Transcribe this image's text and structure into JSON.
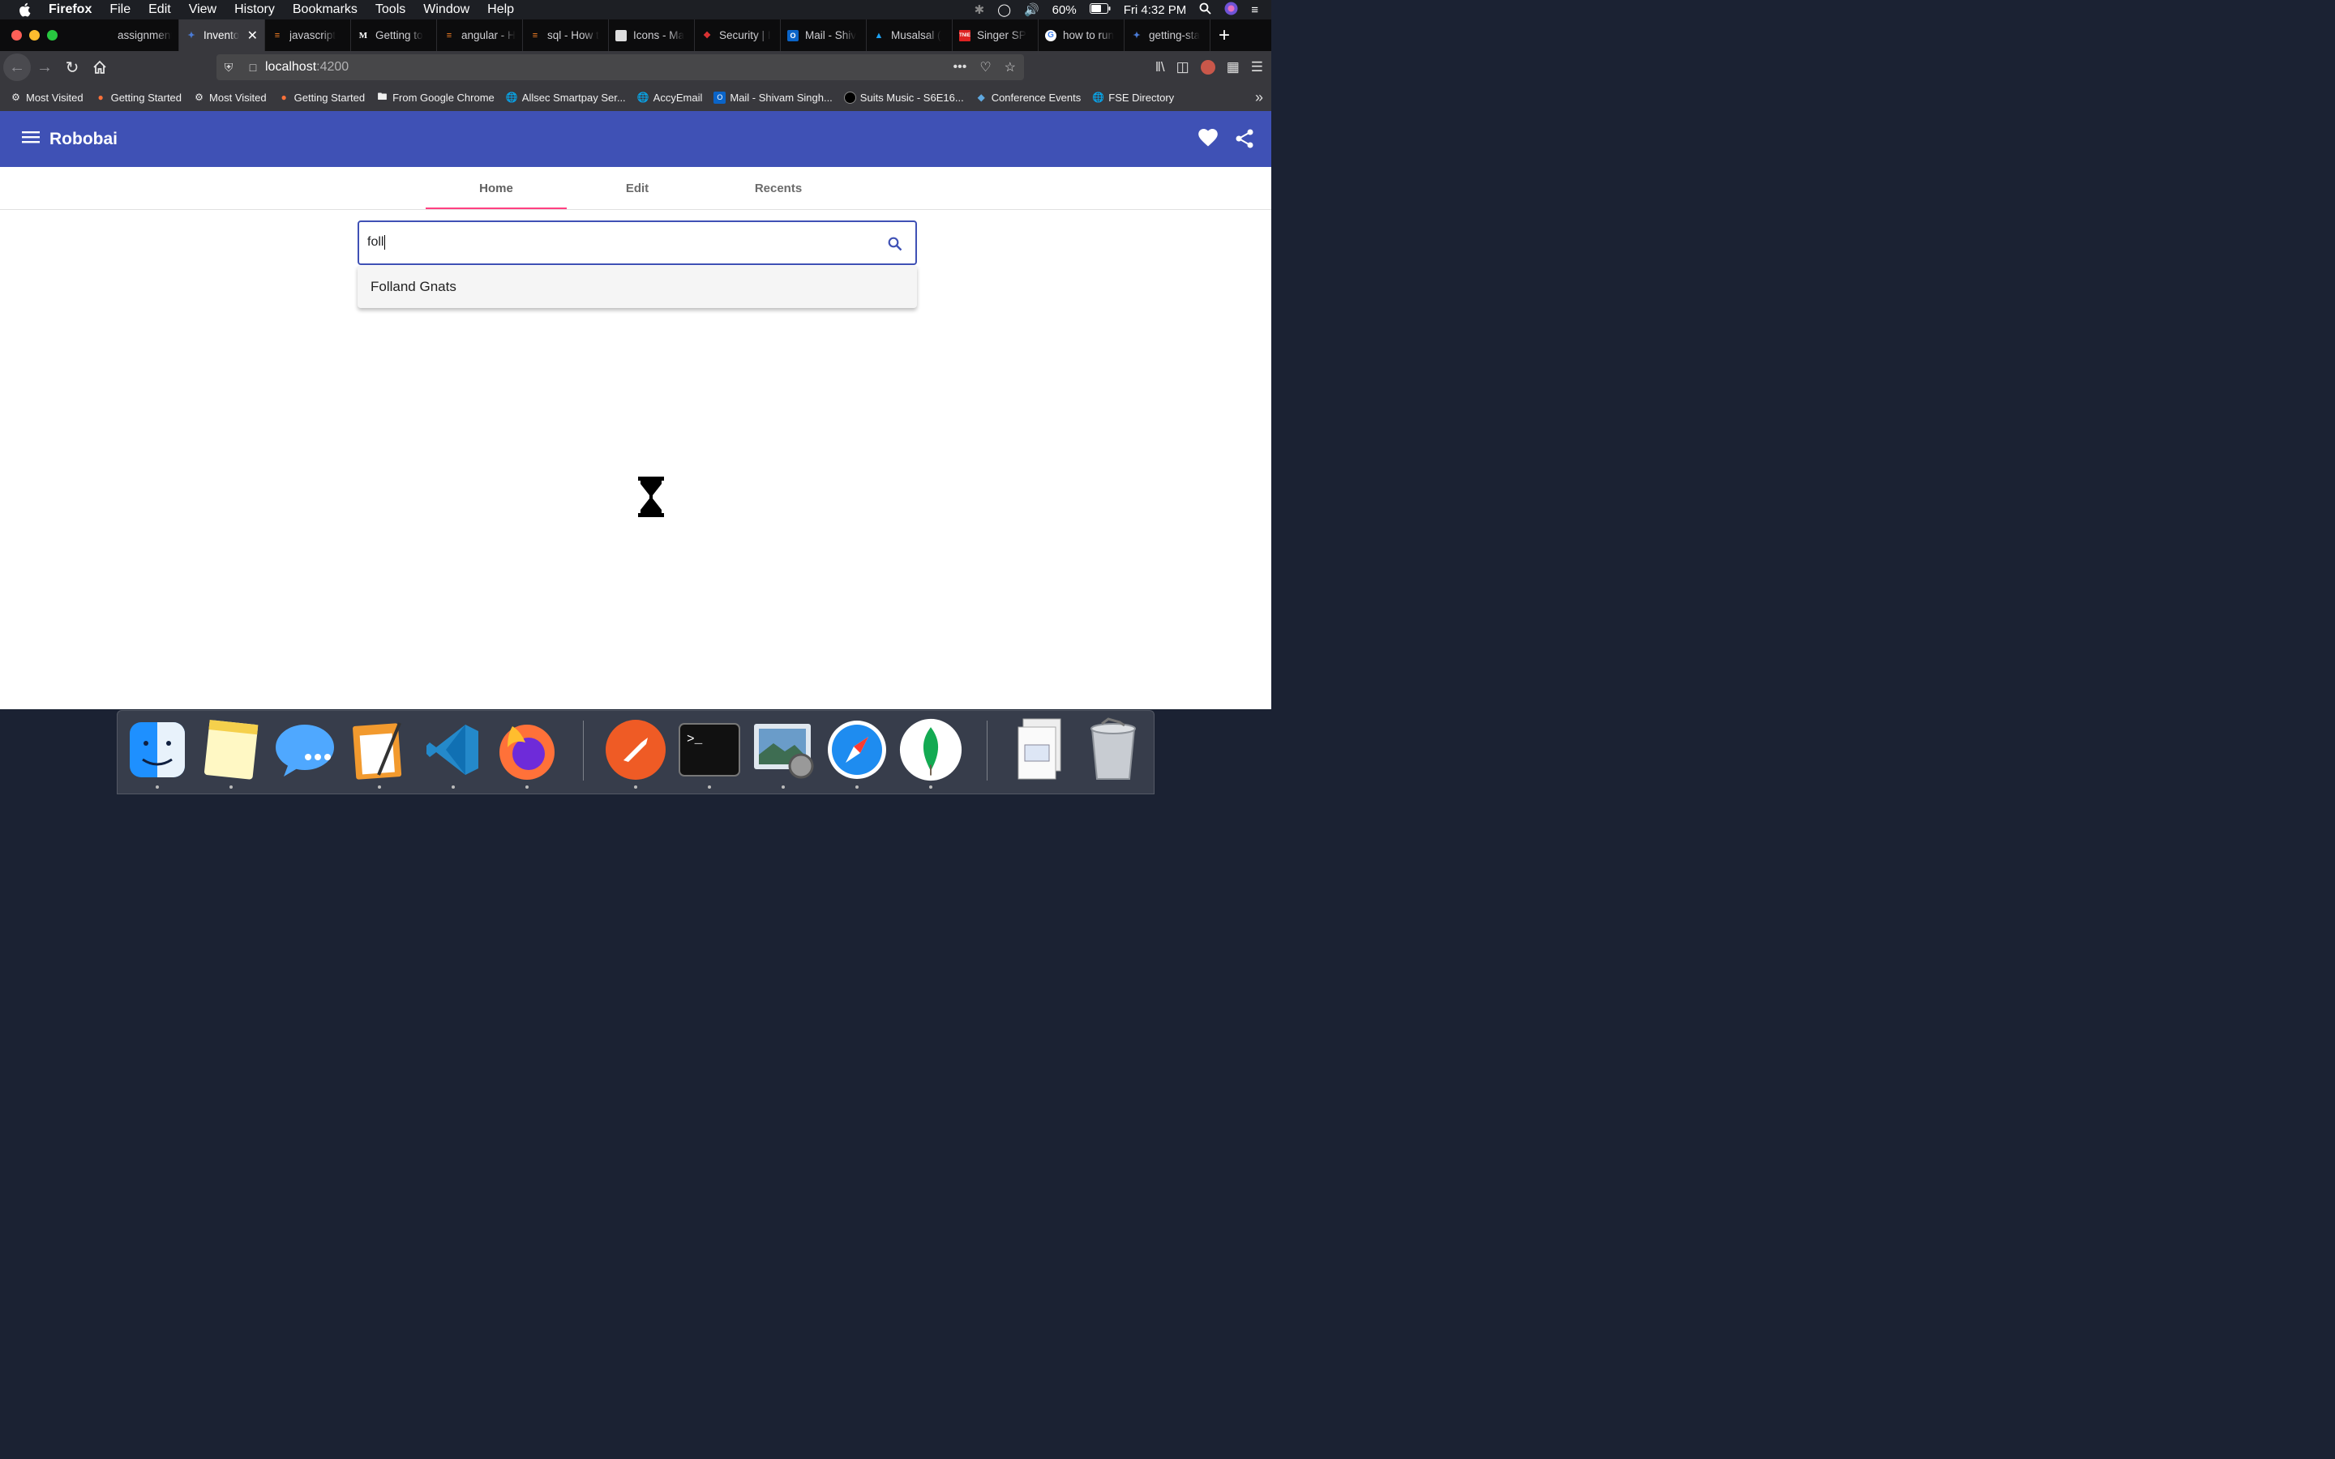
{
  "menubar": {
    "app_name": "Firefox",
    "items": [
      "File",
      "Edit",
      "View",
      "History",
      "Bookmarks",
      "Tools",
      "Window",
      "Help"
    ],
    "battery": "60%",
    "clock": "Fri 4:32 PM"
  },
  "tabs": [
    {
      "label": "assignment - a",
      "icon": "document-icon",
      "active": false
    },
    {
      "label": "Invento",
      "icon": "angular-icon",
      "active": true
    },
    {
      "label": "javascript",
      "icon": "stackoverflow-icon",
      "active": false
    },
    {
      "label": "Getting to",
      "icon": "medium-icon",
      "active": false
    },
    {
      "label": "angular - H",
      "icon": "stackoverflow-icon",
      "active": false
    },
    {
      "label": "sql - How t",
      "icon": "stackoverflow-icon",
      "active": false
    },
    {
      "label": "Icons - Ma",
      "icon": "material-icon",
      "active": false
    },
    {
      "label": "Security | I",
      "icon": "security-icon",
      "active": false
    },
    {
      "label": "Mail - Shiv",
      "icon": "outlook-icon",
      "active": false
    },
    {
      "label": "Musalsal (",
      "icon": "twitter-icon",
      "active": false
    },
    {
      "label": "Singer SP",
      "icon": "tnie-icon",
      "active": false
    },
    {
      "label": "how to run",
      "icon": "google-icon",
      "active": false
    },
    {
      "label": "getting-sta",
      "icon": "angular-icon",
      "active": false
    }
  ],
  "urlbar": {
    "host": "localhost",
    "port": ":4200"
  },
  "bookmarks": [
    {
      "label": "Most Visited",
      "icon": "gear-icon"
    },
    {
      "label": "Getting Started",
      "icon": "firefox-icon"
    },
    {
      "label": "Most Visited",
      "icon": "gear-icon"
    },
    {
      "label": "Getting Started",
      "icon": "firefox-icon"
    },
    {
      "label": "From Google Chrome",
      "icon": "folder-icon"
    },
    {
      "label": "Allsec Smartpay Ser...",
      "icon": "globe-icon"
    },
    {
      "label": "AccyEmail",
      "icon": "globe-icon"
    },
    {
      "label": "Mail - Shivam Singh...",
      "icon": "outlook-icon"
    },
    {
      "label": "Suits Music - S6E16...",
      "icon": "music-icon"
    },
    {
      "label": "Conference Events",
      "icon": "diamond-icon"
    },
    {
      "label": "FSE Directory",
      "icon": "globe-icon"
    }
  ],
  "app": {
    "title": "Robobai",
    "tabs": [
      "Home",
      "Edit",
      "Recents"
    ],
    "active_tab": "Home",
    "search_value": "foll",
    "autocomplete_options": [
      "Folland Gnats"
    ],
    "accent_color": "#3f51b5",
    "ink_color": "#ff4081"
  },
  "dock": {
    "apps": [
      "finder-icon",
      "notes-icon",
      "messages-icon",
      "pages-icon",
      "vscode-icon",
      "firefox-icon",
      "postman-icon",
      "terminal-icon",
      "preview-icon",
      "safari-icon",
      "mongodb-icon",
      "document-stack-icon",
      "trash-icon"
    ]
  }
}
